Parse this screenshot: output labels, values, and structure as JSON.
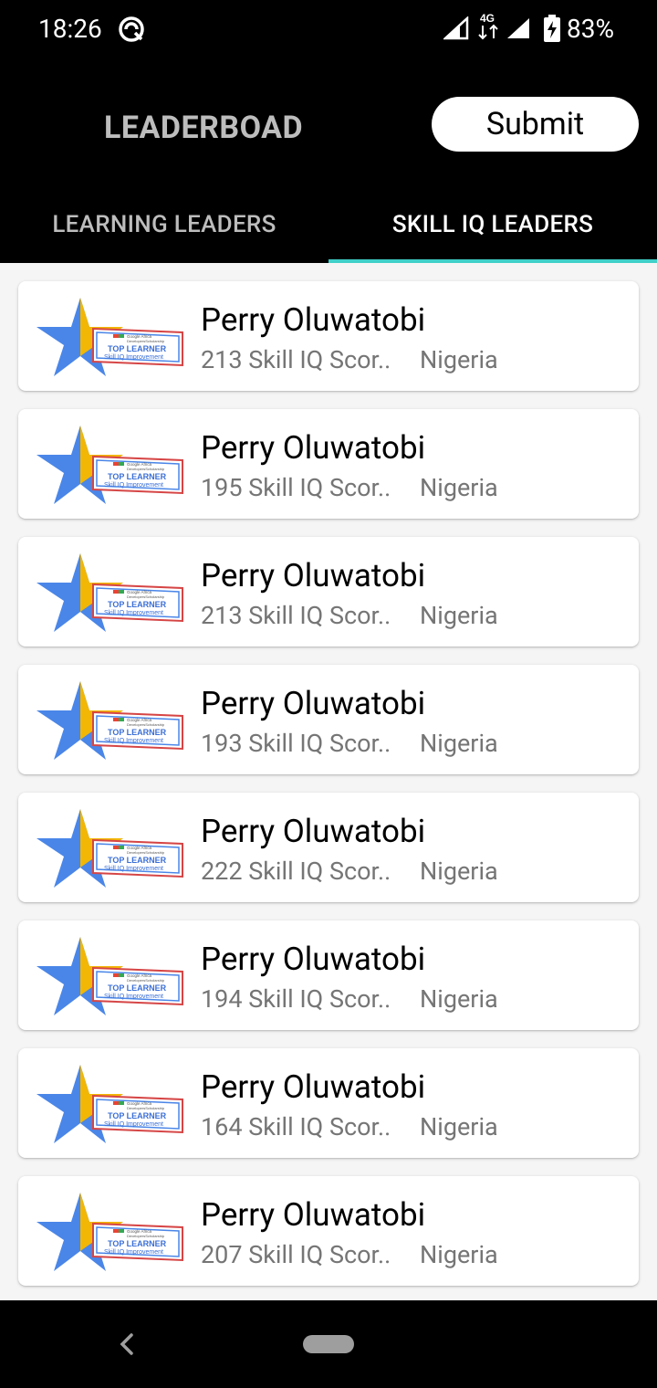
{
  "status_bar": {
    "time": "18:26",
    "network": "4G",
    "battery": "83%"
  },
  "header": {
    "title": "LEADERBOAD",
    "submit_label": "Submit"
  },
  "tabs": [
    {
      "label": "LEARNING LEADERS",
      "selected": false
    },
    {
      "label": "SKILL IQ LEADERS",
      "selected": true
    }
  ],
  "badge": {
    "brand": "Google Africa",
    "program": "DevelopersScholarship",
    "headline": "TOP LEARNER",
    "subline": "Skill IQ Improvement"
  },
  "leaders": [
    {
      "name": "Perry Oluwatobi",
      "score": "213 Skill IQ Scor..",
      "country": "Nigeria"
    },
    {
      "name": "Perry Oluwatobi",
      "score": "195 Skill IQ Scor..",
      "country": "Nigeria"
    },
    {
      "name": "Perry Oluwatobi",
      "score": "213 Skill IQ Scor..",
      "country": "Nigeria"
    },
    {
      "name": "Perry Oluwatobi",
      "score": "193 Skill IQ Scor..",
      "country": "Nigeria"
    },
    {
      "name": "Perry Oluwatobi",
      "score": "222 Skill IQ Scor..",
      "country": "Nigeria"
    },
    {
      "name": "Perry Oluwatobi",
      "score": "194 Skill IQ Scor..",
      "country": "Nigeria"
    },
    {
      "name": "Perry Oluwatobi",
      "score": "164 Skill IQ Scor..",
      "country": "Nigeria"
    },
    {
      "name": "Perry Oluwatobi",
      "score": "207 Skill IQ Scor..",
      "country": "Nigeria"
    }
  ],
  "colors": {
    "accent": "#3fd0c9",
    "appbar": "#000000",
    "star_blue": "#4a86e8",
    "star_gold": "#f2b705"
  }
}
